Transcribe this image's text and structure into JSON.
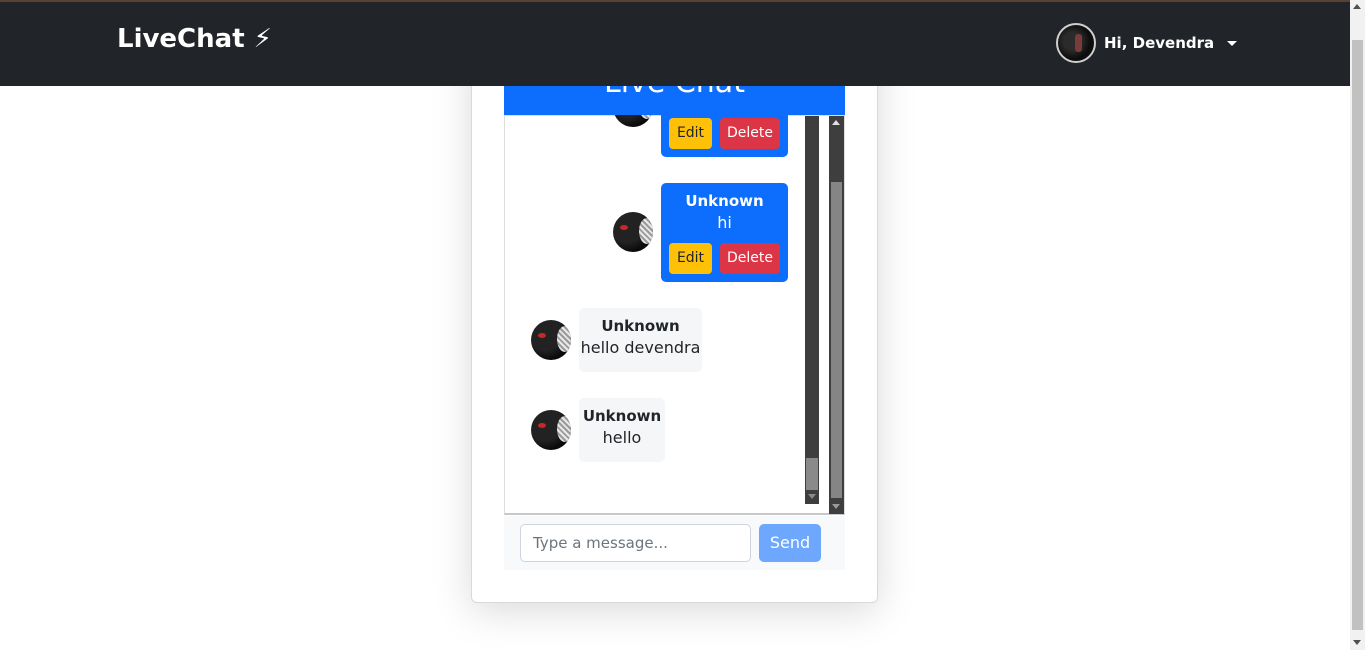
{
  "navbar": {
    "brand": "LiveChat ⚡",
    "greeting": "Hi, Devendra"
  },
  "chat": {
    "header_title": "Live Chat",
    "messages": [
      {
        "sender": "",
        "text": "",
        "own": true,
        "edit_label": "Edit",
        "delete_label": "Delete"
      },
      {
        "sender": "Unknown",
        "text": "hi",
        "own": true,
        "edit_label": "Edit",
        "delete_label": "Delete"
      },
      {
        "sender": "Unknown",
        "text": "hello devendra",
        "own": false
      },
      {
        "sender": "Unknown",
        "text": "hello",
        "own": false
      }
    ],
    "input_placeholder": "Type a message...",
    "send_label": "Send"
  },
  "colors": {
    "navbar_bg": "#212529",
    "primary": "#0d6efd",
    "edit_button": "#ffc107",
    "delete_button": "#dc3545",
    "send_button": "#6ea8fe"
  }
}
